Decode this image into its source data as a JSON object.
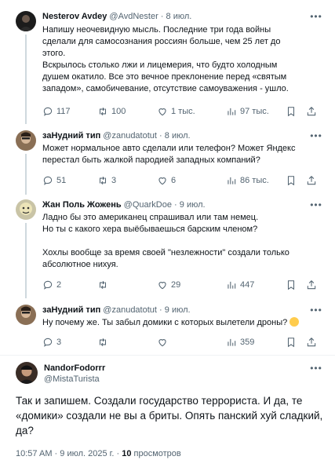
{
  "tweets": [
    {
      "name": "Nesterov Avdey",
      "handle": "@AvdNester",
      "sep": "·",
      "date": "8 июл.",
      "text": "Напишу неочевидную мысль. Последние три года войны\nсделали для самосознания россиян больше, чем 25 лет до\nэтого.\nВскрылось столько лжи и лицемерия, что будто холодным\nдушем окатило. Все это вечное преклонение перед «святым\nзападом», самобичевание, отсутствие самоуважения - ушло.",
      "replies": "117",
      "retweets": "100",
      "likes": "1 тыс.",
      "views": "97 тыс."
    },
    {
      "name": "заНудний тип",
      "handle": "@zanudatotut",
      "sep": "·",
      "date": "8 июл.",
      "text": "Может нормальное авто сделали или телефон? Может Яндекс\nперестал быть жалкой пародией западных компаний?",
      "replies": "51",
      "retweets": "3",
      "likes": "6",
      "views": "86 тыс."
    },
    {
      "name": "Жан Поль Жожень",
      "handle": "@QuarkDoe",
      "sep": "·",
      "date": "9 июл.",
      "text": "Ладно бы это американец спрашивал или там немец.\nНо ты с какого хера выёбываешься барским членом?\n\nХохлы вообще за время своей \"незлежности\" создали только\nабсолютное нихуя.",
      "replies": "2",
      "retweets": "",
      "likes": "29",
      "views": "447"
    },
    {
      "name": "заНудний тип",
      "handle": "@zanudatotut",
      "sep": "·",
      "date": "9 июл.",
      "text": "Ну почему же. Ты забыл домики с которых вылетели дроны?",
      "replies": "3",
      "retweets": "",
      "likes": "",
      "views": "359"
    }
  ],
  "main": {
    "name": "NandorFodorrr",
    "handle": "@MistaTuristа",
    "text": "Так и запишем. Создали государство террориста. И да, те\n«домики» создали не вы а бриты. Опять панский хуй сладкий,\nда?",
    "time": "10:57 AM",
    "dot": "·",
    "date": "9 июл. 2025 г.",
    "views_count": "10",
    "views_label": "просмотров"
  }
}
